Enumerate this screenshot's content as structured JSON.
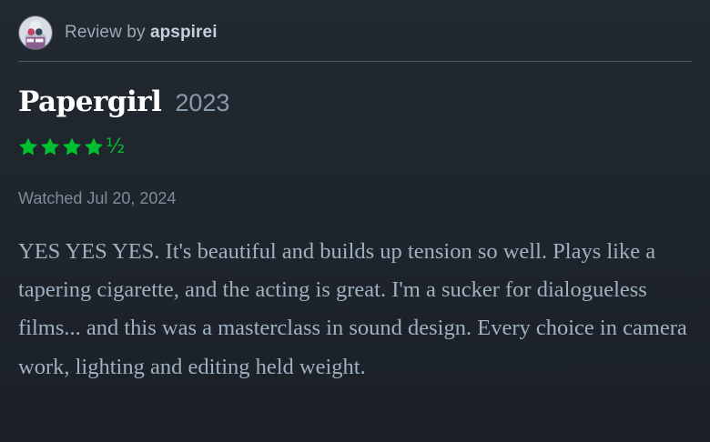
{
  "header": {
    "review_prefix": "Review by",
    "username": "apspirei",
    "avatar_icon": "user-avatar"
  },
  "film": {
    "title": "Papergirl",
    "year": "2023"
  },
  "rating": {
    "stars": 4.5,
    "max_stars": 5,
    "star_color": "#00c030",
    "full_star_icon": "star-icon",
    "half_label": "½"
  },
  "watched": {
    "label": "Watched Jul 20, 2024"
  },
  "review": {
    "text": "YES YES YES. It's beautiful and builds up tension so well. Plays like a tapering cigarette, and the acting is great. I'm a sucker for dialogueless films... and this was a masterclass in sound design. Every choice in camera work, lighting and editing held weight."
  },
  "colors": {
    "background": "#1f252d",
    "title": "#ffffff",
    "body_text": "#9fb0c0",
    "muted_text": "#7f8b99",
    "divider": "#445566",
    "accent_green": "#00c030"
  }
}
